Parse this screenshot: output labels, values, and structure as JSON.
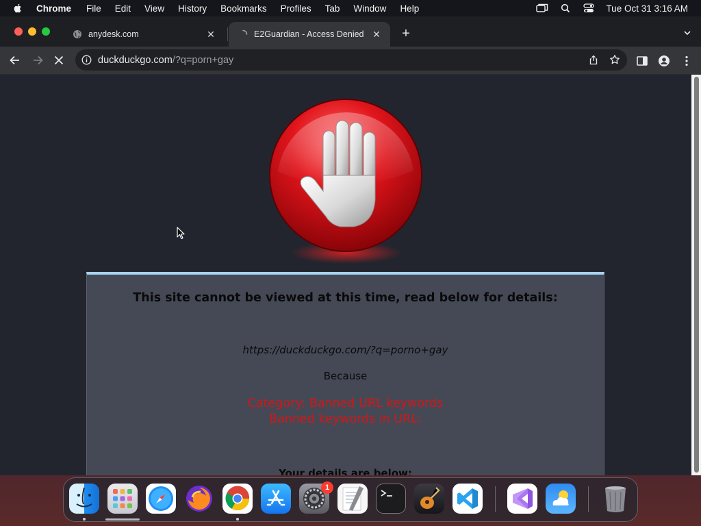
{
  "menubar": {
    "items": [
      "Chrome",
      "File",
      "Edit",
      "View",
      "History",
      "Bookmarks",
      "Profiles",
      "Tab",
      "Window",
      "Help"
    ],
    "clock": "Tue Oct 31  3:16 AM"
  },
  "tabs": [
    {
      "title": "anydesk.com",
      "active": false
    },
    {
      "title": "E2Guardian - Access Denied",
      "active": true
    }
  ],
  "toolbar": {
    "url_host": "duckduckgo.com",
    "url_path": "/?q=porn+gay"
  },
  "page": {
    "heading": "This site cannot be viewed at this time, read below for details:",
    "blocked_url": "https://duckduckgo.com/?q=porno+gay",
    "because": "Because",
    "reason_category": "Category: Banned URL keywords",
    "reason_detail": "Banned keywords in URL:",
    "details_heading": "Your details are below:"
  },
  "dock": {
    "apps": [
      "Finder",
      "Launchpad",
      "Safari",
      "Firefox",
      "Google Chrome",
      "App Store",
      "System Settings",
      "TextEdit",
      "Terminal",
      "GarageBand",
      "Visual Studio Code",
      "Visual Studio",
      "Weather",
      "Trash"
    ],
    "settings_badge": "1"
  },
  "colors": {
    "accent_border": "#a7d3ee",
    "reason_text": "#d41616",
    "panel_bg": "#454956",
    "page_bg": "#23252e"
  }
}
